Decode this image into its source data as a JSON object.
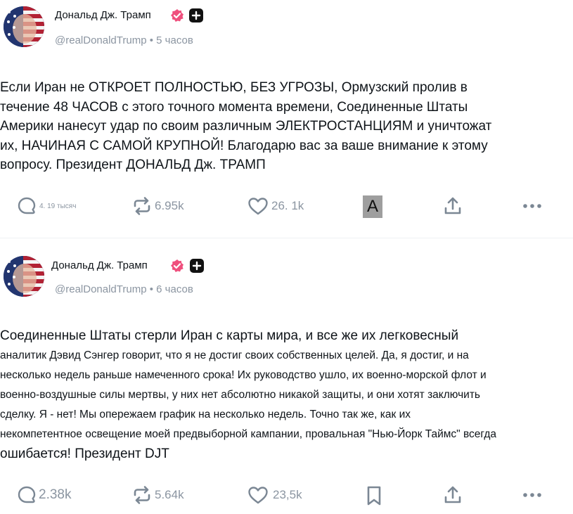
{
  "posts": [
    {
      "author": "Дональд Дж. Трамп",
      "handle": "@realDonaldTrump",
      "time": "5 часов",
      "lines": [
        "Если Иран не ОТКРОЕТ ПОЛНОСТЬЮ, БЕЗ УГРОЗЫ, Ормузский пролив в",
        " течение 48 ЧАСОВ с этого точного момента времени, Соединенные Штаты",
        "  Америки нанесут удар по своим различным ЭЛЕКТРОСТАНЦИЯМ и уничтожат",
        " их, НАЧИНАЯ С САМОЙ КРУПНОЙ! Благодарю вас за ваше внимание к этому",
        "вопросу. Президент ДОНАЛЬД Дж. ТРАМП"
      ],
      "actions": {
        "reply_count": "4. 19 тысяч",
        "repost_count": "6.95k",
        "like_count": "26. 1k",
        "translate_label": "A"
      }
    },
    {
      "author": "Дональд Дж. Трамп",
      "handle": "@realDonaldTrump",
      "time": "6 часов",
      "lines": [
        " Соединенные Штаты стерли Иран с карты мира, и все же их легковесный",
        " аналитик Дэвид Сэнгер говорит, что я не достиг своих собственных целей. Да, я достиг, и на",
        " несколько недель раньше намеченного срока! Их руководство ушло, их военно-морской флот и",
        " военно-воздушные силы мертвы, у них нет абсолютно никакой защиты, и они хотят заключить",
        " сделку. Я - нет! Мы опережаем график на несколько недель. Точно так же, как их",
        "некомпетентное освещение моей предвыборной кампании, провальная \"Нью-Йорк Таймс\" всегда",
        "ошибается! Президент DJT"
      ],
      "actions": {
        "reply_count": "2.38k",
        "repost_count": "5.64k",
        "like_count": "23,5k"
      }
    }
  ],
  "colors": {
    "text": "#0f1419",
    "muted": "#8b95a1",
    "verified_badge": "#ef4f7d",
    "plus_badge": "#111111"
  }
}
